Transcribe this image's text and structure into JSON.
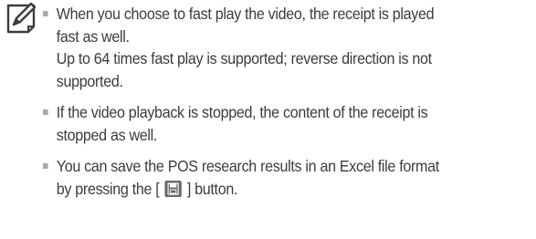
{
  "notes": [
    {
      "lines": [
        "When you choose to fast play the video, the receipt is played",
        "fast as well.",
        "Up to 64 times fast play is supported; reverse direction is not",
        "supported."
      ]
    },
    {
      "lines": [
        "If the video playback is stopped, the content of the receipt is",
        "stopped as well."
      ]
    },
    {
      "lines": [
        "You can save the POS research results in an Excel file format"
      ],
      "last_line_before": "by pressing the [",
      "last_line_after": "] button.",
      "inline_icon": "save-icon"
    }
  ],
  "icons": {
    "note": "note-pencil-icon",
    "bullet_color": "#a8a8a8",
    "button_color": "#6a6a6a"
  }
}
